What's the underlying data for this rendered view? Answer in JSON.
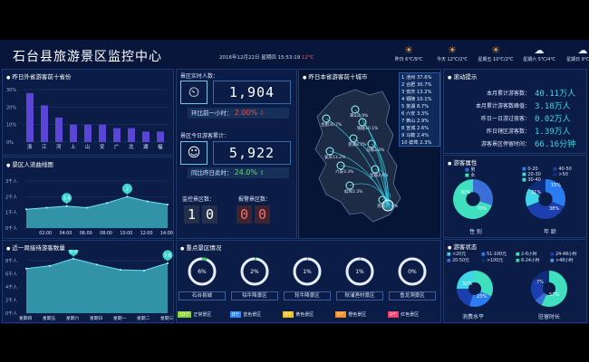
{
  "header": {
    "title": "石台县旅游景区监控中心",
    "datetime": "2016年12月22日  星期四  15:53:19",
    "temp": "12℃",
    "weather": [
      {
        "icon": "sun-icon",
        "text": "昨日 6℃/9℃"
      },
      {
        "icon": "sun-icon",
        "text": "今天 12℃/2℃"
      },
      {
        "icon": "sun-icon",
        "text": "星期五 10℃/2℃"
      },
      {
        "icon": "cloud-icon",
        "text": "星期六 5℃/4℃"
      },
      {
        "icon": "cloud-icon",
        "text": "星期日 9℃/4℃"
      }
    ]
  },
  "provinces": {
    "title": "昨日外省游客前十省份",
    "y_ticks": [
      "30%",
      "20%",
      "10%",
      "0%"
    ],
    "chart_data": {
      "type": "bar",
      "categories": [
        "浙",
        "江",
        "河",
        "上",
        "山",
        "安",
        "广",
        "北",
        "湖",
        "福"
      ],
      "values": [
        28,
        21,
        14,
        10,
        10,
        10,
        8,
        8,
        6,
        6
      ],
      "value_labels": [
        "",
        "",
        "",
        "",
        "",
        "",
        "",
        "",
        "",
        ""
      ],
      "ylim": [
        0,
        30
      ]
    }
  },
  "flow": {
    "title": "景区人流曲线图",
    "y_ticks": [
      "3千人",
      "2千人",
      "1千人",
      "0千人"
    ],
    "x_ticks": [
      "02:00",
      "04:00",
      "06:00",
      "08:00",
      "10:00",
      "12:00",
      "14:00"
    ],
    "markers": [
      "1.4",
      "2"
    ],
    "chart_data": {
      "type": "area",
      "x": [
        "00:00",
        "02:00",
        "04:00",
        "06:00",
        "08:00",
        "10:00",
        "12:00",
        "14:00"
      ],
      "values": [
        1.2,
        1.3,
        1.4,
        1.3,
        1.6,
        2.0,
        1.7,
        1.5
      ],
      "ylim": [
        0,
        3
      ]
    }
  },
  "weekly": {
    "title": "近一周接待游客数量",
    "y_ticks": [
      "8千人",
      "6千人",
      "4千人",
      "2千人",
      "0千人"
    ],
    "x_ticks": [
      "星期四",
      "星期五",
      "星期六",
      "星期日",
      "星期一",
      "星期二",
      "星期三"
    ],
    "markers": [
      "8.3",
      "7.6"
    ],
    "chart_data": {
      "type": "area",
      "categories": [
        "星期四",
        "星期五",
        "星期六",
        "星期日",
        "星期一",
        "星期二",
        "星期三"
      ],
      "values": [
        6.8,
        7.2,
        8.3,
        7.4,
        6.6,
        6.5,
        7.6
      ],
      "ylim": [
        0,
        8
      ]
    }
  },
  "realtime": {
    "title": "景区实时人数：",
    "value": "1,904",
    "compare_label": "环比前一小时：",
    "compare_value": "2.00%",
    "today_title": "景区今日游客累计：",
    "today_value": "5,922",
    "today_compare_label": "同比昨日此时：",
    "today_compare_value": "24.0%",
    "monitor_label": "监控景区数：",
    "monitor_digits": [
      "1",
      "0"
    ],
    "alarm_label": "报警景区数：",
    "alarm_digits": [
      "0",
      "0"
    ]
  },
  "map": {
    "title": "昨日本省游客前十城市",
    "list": [
      "1 池州 37.6%",
      "2 合肥 30.7%",
      "3 安庆 13.2%",
      "4 铜陵 10.1%",
      "5 芜湖 8.7%",
      "6 六安 3.3%",
      "7 黄山 2.9%",
      "8 宣城 2.6%",
      "9 马鞍 2.4%",
      "10 蚌埠 2.3%"
    ],
    "city_labels": [
      "合肥30.7%",
      "铜陵10.1%",
      "安庆13.2%",
      "芜湖8.7%",
      "六安3.3%",
      "马鞍2.4%",
      "黄山2.9%",
      "宣城2.6%",
      "蚌埠2.3%",
      "池州37.6%"
    ]
  },
  "scroll": {
    "title": "滚动提示",
    "items": [
      {
        "label": "本月累计游客数：",
        "value": "40.11万人"
      },
      {
        "label": "本月累计游客数峰值：",
        "value": "3.18万人"
      },
      {
        "label": "昨日一日游过夜客：",
        "value": "0.02万人"
      },
      {
        "label": "昨日辖区游客数：",
        "value": "1.39万人"
      },
      {
        "label": "游客景区停留时间：",
        "value": "66.16分钟"
      }
    ]
  },
  "attr": {
    "title": "游客属性",
    "gender_legend": [
      "男",
      "女"
    ],
    "age_legend": [
      "0-20",
      "40-50",
      "20-30",
      ">50",
      "30-40"
    ],
    "gender_label": "性 别",
    "age_label": "年 龄",
    "gender_values": [
      "30%",
      "70%"
    ],
    "age_values": [
      "31%",
      "38%",
      "15%"
    ]
  },
  "status": {
    "title": "游客状态",
    "legend": [
      "<20元",
      "51-100元",
      "2-6小时",
      "24-48小时",
      "20-50元",
      ">100元",
      "6-24小时",
      ">48小时"
    ],
    "spend_label": "消费水平",
    "stay_label": "驻留时长",
    "spend_values": [
      "32%",
      "23%"
    ],
    "stay_values": [
      "57%",
      "7%"
    ]
  },
  "scenic": {
    "title": "重点景区情况",
    "items": [
      {
        "name": "石台县城",
        "value": "6%"
      },
      {
        "name": "牯牛降景区",
        "value": "2%"
      },
      {
        "name": "轮牛降景区",
        "value": "1%"
      },
      {
        "name": "秋浦渔村景区",
        "value": "1%"
      },
      {
        "name": "鱼龙洞景区",
        "value": "0%"
      }
    ],
    "legend": [
      {
        "count": "10个",
        "label": "正常景区",
        "color": "#8fd13a"
      },
      {
        "count": "0个",
        "label": "蓝色景区",
        "color": "#2e8bff"
      },
      {
        "count": "0个",
        "label": "黄色景区",
        "color": "#f0c020"
      },
      {
        "count": "0个",
        "label": "橙色景区",
        "color": "#ff8a20"
      },
      {
        "count": "0个",
        "label": "红色景区",
        "color": "#ff3a6a"
      }
    ]
  }
}
